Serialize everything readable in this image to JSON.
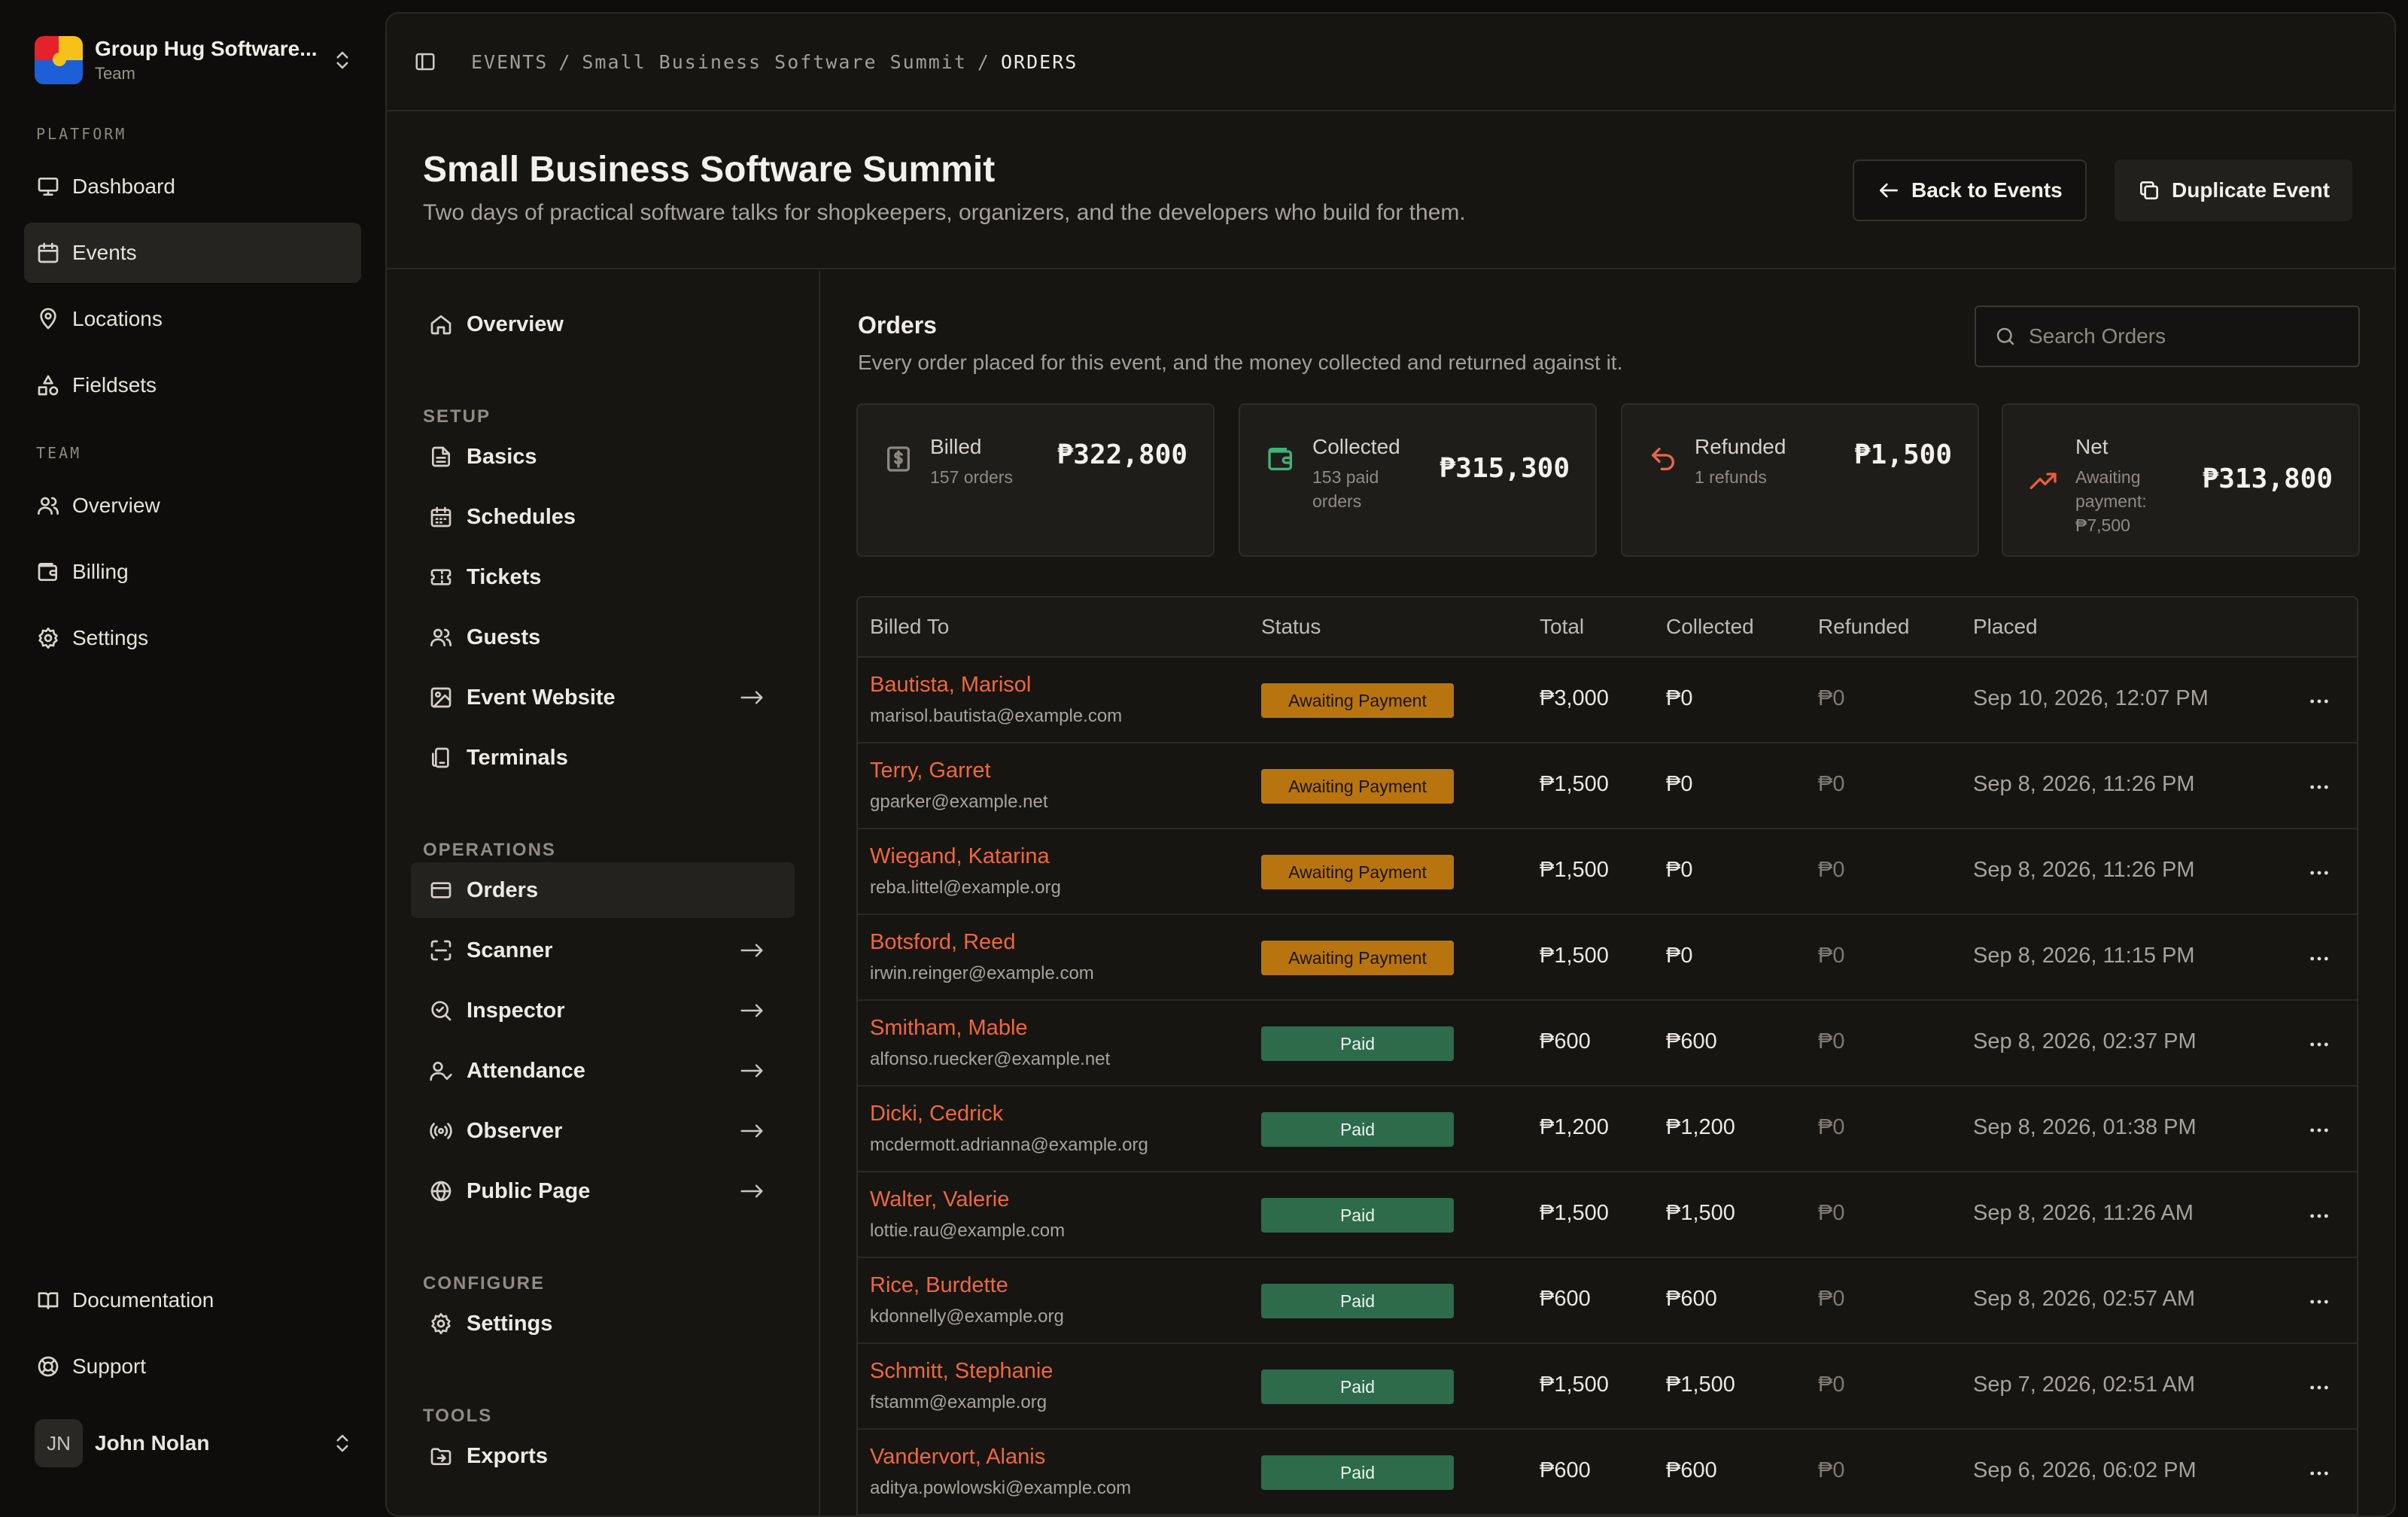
{
  "team": {
    "name": "Group Hug Software...",
    "sub": "Team"
  },
  "sidebar": {
    "platform_label": "PLATFORM",
    "platform": [
      {
        "label": "Dashboard",
        "icon": "monitor-icon"
      },
      {
        "label": "Events",
        "icon": "calendar-icon",
        "active": true
      },
      {
        "label": "Locations",
        "icon": "map-pin-icon"
      },
      {
        "label": "Fieldsets",
        "icon": "shapes-icon"
      }
    ],
    "team_label": "TEAM",
    "team": [
      {
        "label": "Overview",
        "icon": "users-icon"
      },
      {
        "label": "Billing",
        "icon": "wallet-icon"
      },
      {
        "label": "Settings",
        "icon": "gear-icon"
      }
    ],
    "footer": [
      {
        "label": "Documentation",
        "icon": "book-icon"
      },
      {
        "label": "Support",
        "icon": "life-buoy-icon"
      }
    ],
    "user": {
      "initials": "JN",
      "name": "John Nolan"
    }
  },
  "breadcrumb": {
    "root": "EVENTS",
    "sep": "/",
    "event": "Small Business Software Summit",
    "current": "ORDERS"
  },
  "event": {
    "title": "Small Business Software Summit",
    "description": "Two days of practical software talks for shopkeepers, organizers, and the developers who build for them.",
    "back_label": "Back to Events",
    "duplicate_label": "Duplicate Event"
  },
  "subnav": {
    "overview": "Overview",
    "setup_label": "SETUP",
    "setup": [
      "Basics",
      "Schedules",
      "Tickets",
      "Guests",
      "Event Website",
      "Terminals"
    ],
    "operations_label": "OPERATIONS",
    "operations": [
      "Orders",
      "Scanner",
      "Inspector",
      "Attendance",
      "Observer",
      "Public Page"
    ],
    "configure_label": "CONFIGURE",
    "configure": [
      "Settings"
    ],
    "tools_label": "TOOLS",
    "tools": [
      "Exports"
    ]
  },
  "orders": {
    "title": "Orders",
    "description": "Every order placed for this event, and the money collected and returned against it.",
    "search_placeholder": "Search Orders"
  },
  "stats": [
    {
      "label": "Billed",
      "sub": "157 orders",
      "value": "₱322,800",
      "color": "#8c8780",
      "icon": "dollar-icon"
    },
    {
      "label": "Collected",
      "sub": "153 paid orders",
      "value": "₱315,300",
      "color": "#3fb37a",
      "icon": "wallet-icon"
    },
    {
      "label": "Refunded",
      "sub": "1 refunds",
      "value": "₱1,500",
      "color": "#e8674a",
      "icon": "undo-icon"
    },
    {
      "label": "Net",
      "sub": "Awaiting payment: ₱7,500",
      "value": "₱313,800",
      "color": "#ef5a3c",
      "icon": "trending-up-icon"
    }
  ],
  "table": {
    "headers": [
      "Billed To",
      "Status",
      "Total",
      "Collected",
      "Refunded",
      "Placed"
    ],
    "rows": [
      {
        "name": "Bautista, Marisol",
        "email": "marisol.bautista@example.com",
        "status": "Awaiting Payment",
        "total": "₱3,000",
        "collected": "₱0",
        "refunded": "₱0",
        "placed": "Sep 10, 2026, 12:07 PM"
      },
      {
        "name": "Terry, Garret",
        "email": "gparker@example.net",
        "status": "Awaiting Payment",
        "total": "₱1,500",
        "collected": "₱0",
        "refunded": "₱0",
        "placed": "Sep 8, 2026, 11:26 PM"
      },
      {
        "name": "Wiegand, Katarina",
        "email": "reba.littel@example.org",
        "status": "Awaiting Payment",
        "total": "₱1,500",
        "collected": "₱0",
        "refunded": "₱0",
        "placed": "Sep 8, 2026, 11:26 PM"
      },
      {
        "name": "Botsford, Reed",
        "email": "irwin.reinger@example.com",
        "status": "Awaiting Payment",
        "total": "₱1,500",
        "collected": "₱0",
        "refunded": "₱0",
        "placed": "Sep 8, 2026, 11:15 PM"
      },
      {
        "name": "Smitham, Mable",
        "email": "alfonso.ruecker@example.net",
        "status": "Paid",
        "total": "₱600",
        "collected": "₱600",
        "refunded": "₱0",
        "placed": "Sep 8, 2026, 02:37 PM"
      },
      {
        "name": "Dicki, Cedrick",
        "email": "mcdermott.adrianna@example.org",
        "status": "Paid",
        "total": "₱1,200",
        "collected": "₱1,200",
        "refunded": "₱0",
        "placed": "Sep 8, 2026, 01:38 PM"
      },
      {
        "name": "Walter, Valerie",
        "email": "lottie.rau@example.com",
        "status": "Paid",
        "total": "₱1,500",
        "collected": "₱1,500",
        "refunded": "₱0",
        "placed": "Sep 8, 2026, 11:26 AM"
      },
      {
        "name": "Rice, Burdette",
        "email": "kdonnelly@example.org",
        "status": "Paid",
        "total": "₱600",
        "collected": "₱600",
        "refunded": "₱0",
        "placed": "Sep 8, 2026, 02:57 AM"
      },
      {
        "name": "Schmitt, Stephanie",
        "email": "fstamm@example.org",
        "status": "Paid",
        "total": "₱1,500",
        "collected": "₱1,500",
        "refunded": "₱0",
        "placed": "Sep 7, 2026, 02:51 AM"
      },
      {
        "name": "Vandervort, Alanis",
        "email": "aditya.powlowski@example.com",
        "status": "Paid",
        "total": "₱600",
        "collected": "₱600",
        "refunded": "₱0",
        "placed": "Sep 6, 2026, 06:02 PM"
      }
    ]
  }
}
